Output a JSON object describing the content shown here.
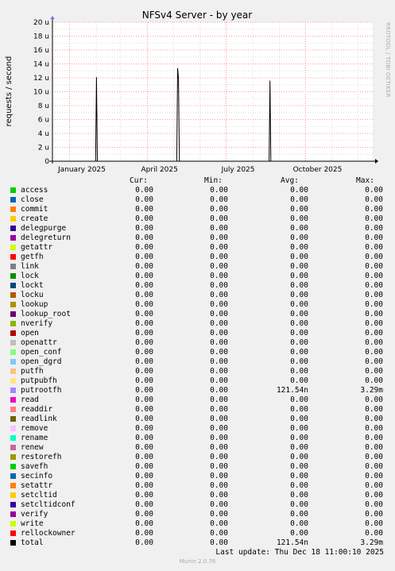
{
  "title": "NFSv4 Server - by year",
  "side_label": "RRDTOOL / TOBI OETIKER",
  "footer": {
    "last_update": "Last update: Thu Dec 18 11:00:10 2025",
    "munin": "Munin 2.0.76"
  },
  "colors": {
    "background": "#f0f0f0",
    "plot_bg": "#ffffff",
    "grid_major": "#ff9999",
    "grid_minor": "#dddddd",
    "line": "#000000"
  },
  "chart_data": {
    "type": "line",
    "title": "NFSv4 Server - by year",
    "ylabel": "requests / second",
    "ylim": [
      0,
      20
    ],
    "yticks": [
      "0",
      "2 u",
      "4 u",
      "6 u",
      "8 u",
      "10 u",
      "12 u",
      "14 u",
      "16 u",
      "18 u",
      "20 u"
    ],
    "xlim": [
      "2024-12-12",
      "2025-12-18"
    ],
    "xticks": [
      {
        "label": "January 2025",
        "date": "2025-01-15"
      },
      {
        "label": "April 2025",
        "date": "2025-04-15"
      },
      {
        "label": "July 2025",
        "date": "2025-07-15"
      },
      {
        "label": "October 2025",
        "date": "2025-10-15"
      }
    ],
    "series": [
      {
        "name": "total",
        "color": "#000000",
        "points": [
          [
            "2025-01-31",
            0
          ],
          [
            "2025-02-01",
            12.1
          ],
          [
            "2025-02-02",
            0
          ],
          [
            "2025-05-05",
            0
          ],
          [
            "2025-05-06",
            13.4
          ],
          [
            "2025-05-07",
            11.8
          ],
          [
            "2025-05-08",
            0
          ],
          [
            "2025-08-20",
            0
          ],
          [
            "2025-08-21",
            11.6
          ],
          [
            "2025-08-22",
            0
          ]
        ]
      }
    ]
  },
  "legend": {
    "headers": {
      "cur": "Cur:",
      "min": "Min:",
      "avg": "Avg:",
      "max": "Max:"
    },
    "rows": [
      {
        "name": "access",
        "color": "#00cc00",
        "cur": "0.00",
        "min": "0.00",
        "avg": "0.00",
        "max": "0.00"
      },
      {
        "name": "close",
        "color": "#0066b3",
        "cur": "0.00",
        "min": "0.00",
        "avg": "0.00",
        "max": "0.00"
      },
      {
        "name": "commit",
        "color": "#ff8000",
        "cur": "0.00",
        "min": "0.00",
        "avg": "0.00",
        "max": "0.00"
      },
      {
        "name": "create",
        "color": "#ffcc00",
        "cur": "0.00",
        "min": "0.00",
        "avg": "0.00",
        "max": "0.00"
      },
      {
        "name": "delegpurge",
        "color": "#330099",
        "cur": "0.00",
        "min": "0.00",
        "avg": "0.00",
        "max": "0.00"
      },
      {
        "name": "delegreturn",
        "color": "#990099",
        "cur": "0.00",
        "min": "0.00",
        "avg": "0.00",
        "max": "0.00"
      },
      {
        "name": "getattr",
        "color": "#ccff00",
        "cur": "0.00",
        "min": "0.00",
        "avg": "0.00",
        "max": "0.00"
      },
      {
        "name": "getfh",
        "color": "#ff0000",
        "cur": "0.00",
        "min": "0.00",
        "avg": "0.00",
        "max": "0.00"
      },
      {
        "name": "link",
        "color": "#808080",
        "cur": "0.00",
        "min": "0.00",
        "avg": "0.00",
        "max": "0.00"
      },
      {
        "name": "lock",
        "color": "#008f00",
        "cur": "0.00",
        "min": "0.00",
        "avg": "0.00",
        "max": "0.00"
      },
      {
        "name": "lockt",
        "color": "#00487d",
        "cur": "0.00",
        "min": "0.00",
        "avg": "0.00",
        "max": "0.00"
      },
      {
        "name": "locku",
        "color": "#b35a00",
        "cur": "0.00",
        "min": "0.00",
        "avg": "0.00",
        "max": "0.00"
      },
      {
        "name": "lookup",
        "color": "#b38f00",
        "cur": "0.00",
        "min": "0.00",
        "avg": "0.00",
        "max": "0.00"
      },
      {
        "name": "lookup_root",
        "color": "#6b006b",
        "cur": "0.00",
        "min": "0.00",
        "avg": "0.00",
        "max": "0.00"
      },
      {
        "name": "nverify",
        "color": "#8fb300",
        "cur": "0.00",
        "min": "0.00",
        "avg": "0.00",
        "max": "0.00"
      },
      {
        "name": "open",
        "color": "#b30000",
        "cur": "0.00",
        "min": "0.00",
        "avg": "0.00",
        "max": "0.00"
      },
      {
        "name": "openattr",
        "color": "#bebebe",
        "cur": "0.00",
        "min": "0.00",
        "avg": "0.00",
        "max": "0.00"
      },
      {
        "name": "open_conf",
        "color": "#80ff80",
        "cur": "0.00",
        "min": "0.00",
        "avg": "0.00",
        "max": "0.00"
      },
      {
        "name": "open_dgrd",
        "color": "#80c9ff",
        "cur": "0.00",
        "min": "0.00",
        "avg": "0.00",
        "max": "0.00"
      },
      {
        "name": "putfh",
        "color": "#ffc080",
        "cur": "0.00",
        "min": "0.00",
        "avg": "0.00",
        "max": "0.00"
      },
      {
        "name": "putpubfh",
        "color": "#ffe680",
        "cur": "0.00",
        "min": "0.00",
        "avg": "0.00",
        "max": "0.00"
      },
      {
        "name": "putrootfh",
        "color": "#aa80ff",
        "cur": "0.00",
        "min": "0.00",
        "avg": "121.54n",
        "max": "3.29m"
      },
      {
        "name": "read",
        "color": "#ee00cc",
        "cur": "0.00",
        "min": "0.00",
        "avg": "0.00",
        "max": "0.00"
      },
      {
        "name": "readdir",
        "color": "#ff8080",
        "cur": "0.00",
        "min": "0.00",
        "avg": "0.00",
        "max": "0.00"
      },
      {
        "name": "readlink",
        "color": "#666600",
        "cur": "0.00",
        "min": "0.00",
        "avg": "0.00",
        "max": "0.00"
      },
      {
        "name": "remove",
        "color": "#ffbfff",
        "cur": "0.00",
        "min": "0.00",
        "avg": "0.00",
        "max": "0.00"
      },
      {
        "name": "rename",
        "color": "#00ffcc",
        "cur": "0.00",
        "min": "0.00",
        "avg": "0.00",
        "max": "0.00"
      },
      {
        "name": "renew",
        "color": "#cc6699",
        "cur": "0.00",
        "min": "0.00",
        "avg": "0.00",
        "max": "0.00"
      },
      {
        "name": "restorefh",
        "color": "#999900",
        "cur": "0.00",
        "min": "0.00",
        "avg": "0.00",
        "max": "0.00"
      },
      {
        "name": "savefh",
        "color": "#00cc00",
        "cur": "0.00",
        "min": "0.00",
        "avg": "0.00",
        "max": "0.00"
      },
      {
        "name": "secinfo",
        "color": "#0066b3",
        "cur": "0.00",
        "min": "0.00",
        "avg": "0.00",
        "max": "0.00"
      },
      {
        "name": "setattr",
        "color": "#ff8000",
        "cur": "0.00",
        "min": "0.00",
        "avg": "0.00",
        "max": "0.00"
      },
      {
        "name": "setcltid",
        "color": "#ffcc00",
        "cur": "0.00",
        "min": "0.00",
        "avg": "0.00",
        "max": "0.00"
      },
      {
        "name": "setcltidconf",
        "color": "#330099",
        "cur": "0.00",
        "min": "0.00",
        "avg": "0.00",
        "max": "0.00"
      },
      {
        "name": "verify",
        "color": "#990099",
        "cur": "0.00",
        "min": "0.00",
        "avg": "0.00",
        "max": "0.00"
      },
      {
        "name": "write",
        "color": "#ccff00",
        "cur": "0.00",
        "min": "0.00",
        "avg": "0.00",
        "max": "0.00"
      },
      {
        "name": "rellockowner",
        "color": "#ff0000",
        "cur": "0.00",
        "min": "0.00",
        "avg": "0.00",
        "max": "0.00"
      },
      {
        "name": "total",
        "color": "#000000",
        "cur": "0.00",
        "min": "0.00",
        "avg": "121.54n",
        "max": "3.29m"
      }
    ]
  }
}
